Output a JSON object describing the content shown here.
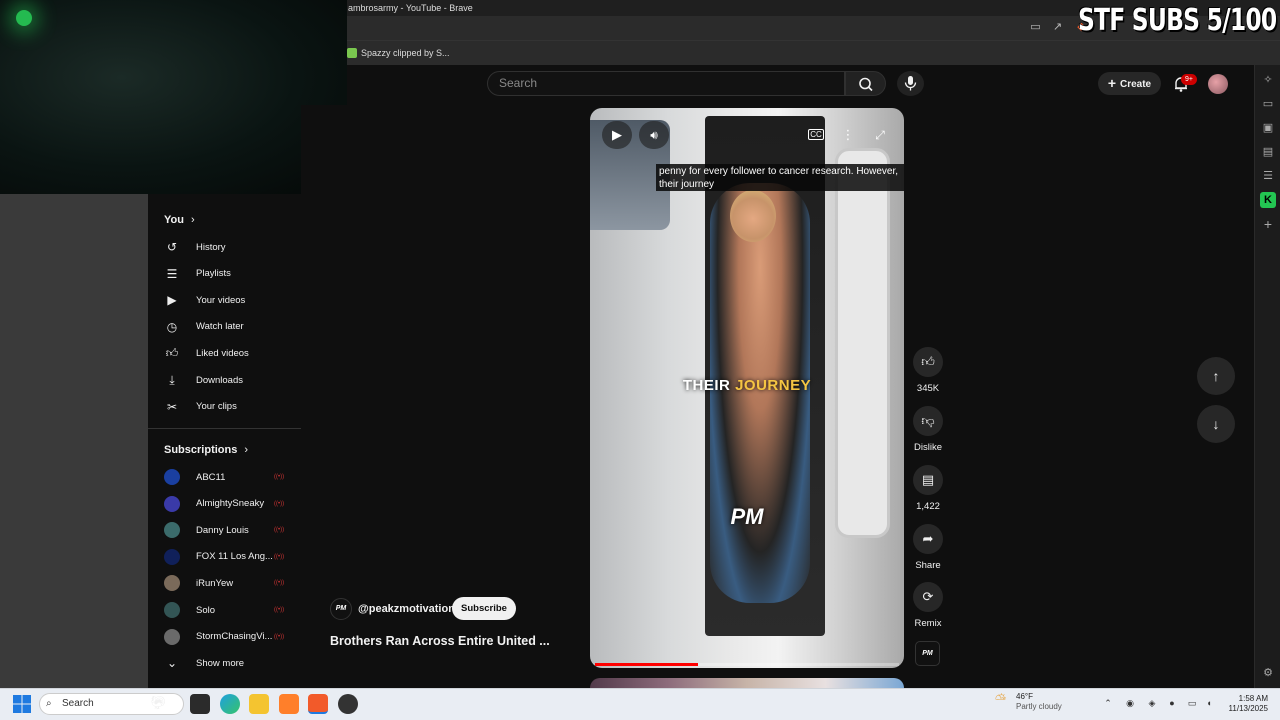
{
  "browser": {
    "window_title": "ambrosarmy - YouTube - Brave",
    "bookmark": "Spazzy clipped by S..."
  },
  "overlay": {
    "subs_counter": "STF SUBS 5/100"
  },
  "youtube_header": {
    "search_placeholder": "Search",
    "create_label": "Create",
    "notification_count": "9+"
  },
  "guide": {
    "you_heading": "You",
    "you_items": [
      {
        "label": "History",
        "icon": "history-icon"
      },
      {
        "label": "Playlists",
        "icon": "playlists-icon"
      },
      {
        "label": "Your videos",
        "icon": "your-videos-icon"
      },
      {
        "label": "Watch later",
        "icon": "watch-later-icon"
      },
      {
        "label": "Liked videos",
        "icon": "thumbs-up-icon"
      },
      {
        "label": "Downloads",
        "icon": "download-icon"
      },
      {
        "label": "Your clips",
        "icon": "scissors-icon"
      }
    ],
    "subscriptions_heading": "Subscriptions",
    "subscriptions": [
      {
        "name": "ABC11",
        "live": true,
        "color": "#1a3fa0"
      },
      {
        "name": "AlmightySneaky",
        "live": true,
        "color": "#3a3aa8"
      },
      {
        "name": "Danny Louis",
        "live": true,
        "color": "#3b6b6b"
      },
      {
        "name": "FOX 11 Los Ang...",
        "live": true,
        "color": "#10205a"
      },
      {
        "name": "iRunYew",
        "live": true,
        "color": "#7a6a5a"
      },
      {
        "name": "Solo",
        "live": true,
        "color": "#335555"
      },
      {
        "name": "StormChasingVi...",
        "live": true,
        "color": "#6a6a6a"
      }
    ],
    "show_more": "Show more"
  },
  "short": {
    "caption": "penny for every follower to cancer research. However, their journey",
    "overlay_text_white": "THEIR ",
    "overlay_text_yellow": "JOURNEY",
    "watermark": "PM",
    "progress_fraction": 0.34,
    "channel_handle": "@peakzmotivation",
    "channel_logo": "PM",
    "subscribe_label": "Subscribe",
    "title": "Brothers Ran Across Entire United ...",
    "actions": {
      "likes": "345K",
      "dislike": "Dislike",
      "comments": "1,422",
      "share": "Share",
      "remix": "Remix"
    }
  },
  "taskbar": {
    "search_placeholder": "Search",
    "weather_temp": "46°F",
    "weather_desc": "Partly cloudy",
    "time": "1:58 AM",
    "date": "11/13/2025"
  },
  "colors": {
    "youtube_red": "#ff0000",
    "background": "#0f0f0f",
    "chip": "#272727"
  }
}
